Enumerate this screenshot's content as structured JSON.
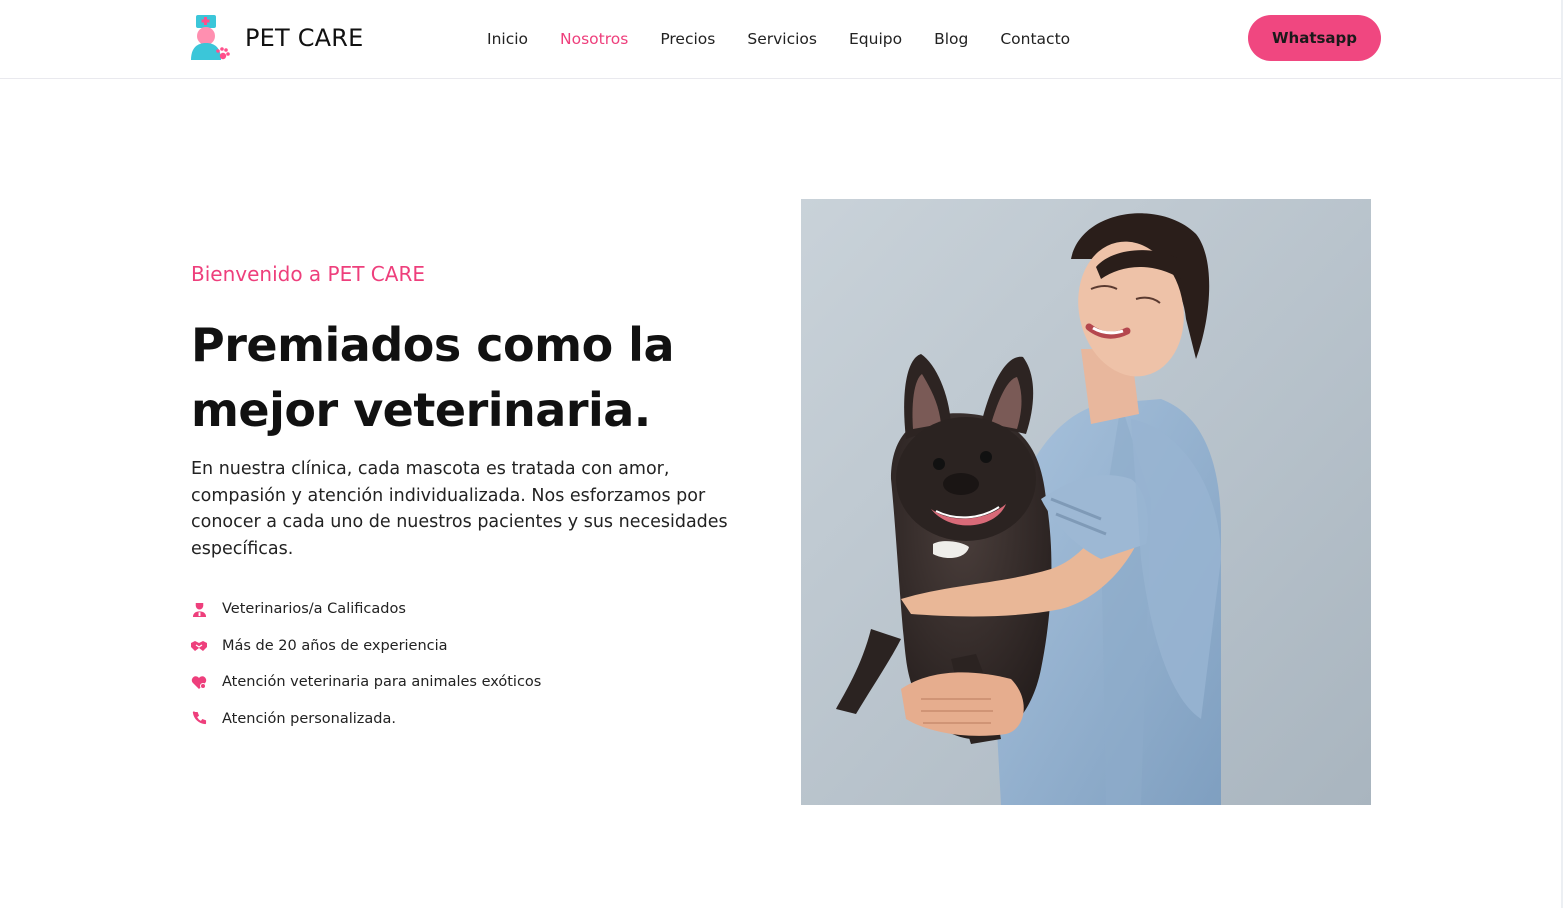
{
  "brand": {
    "name": "PET CARE"
  },
  "nav": {
    "links": [
      {
        "label": "Inicio",
        "active": false
      },
      {
        "label": "Nosotros",
        "active": true
      },
      {
        "label": "Precios",
        "active": false
      },
      {
        "label": "Servicios",
        "active": false
      },
      {
        "label": "Equipo",
        "active": false
      },
      {
        "label": "Blog",
        "active": false
      },
      {
        "label": "Contacto",
        "active": false
      }
    ],
    "cta_label": "Whatsapp"
  },
  "hero": {
    "eyebrow": "Bienvenido a PET CARE",
    "headline_line1": "Premiados como la",
    "headline_line2": "mejor veterinaria.",
    "lead": "En nuestra clínica, cada mascota es tratada con amor, compasión y atención individualizada. Nos esforzamos por conocer a cada uno de nuestros pacientes y sus necesidades específicas.",
    "features": [
      {
        "icon": "doctor-icon",
        "text": "Veterinarios/a Calificados"
      },
      {
        "icon": "handshake-icon",
        "text": "Más de 20 años de experiencia"
      },
      {
        "icon": "heart-care-icon",
        "text": "Atención veterinaria para animales exóticos"
      },
      {
        "icon": "phone-icon",
        "text": "Atención personalizada."
      }
    ]
  },
  "colors": {
    "accent": "#ee3f7c",
    "button": "#f04780",
    "text": "#111111"
  }
}
